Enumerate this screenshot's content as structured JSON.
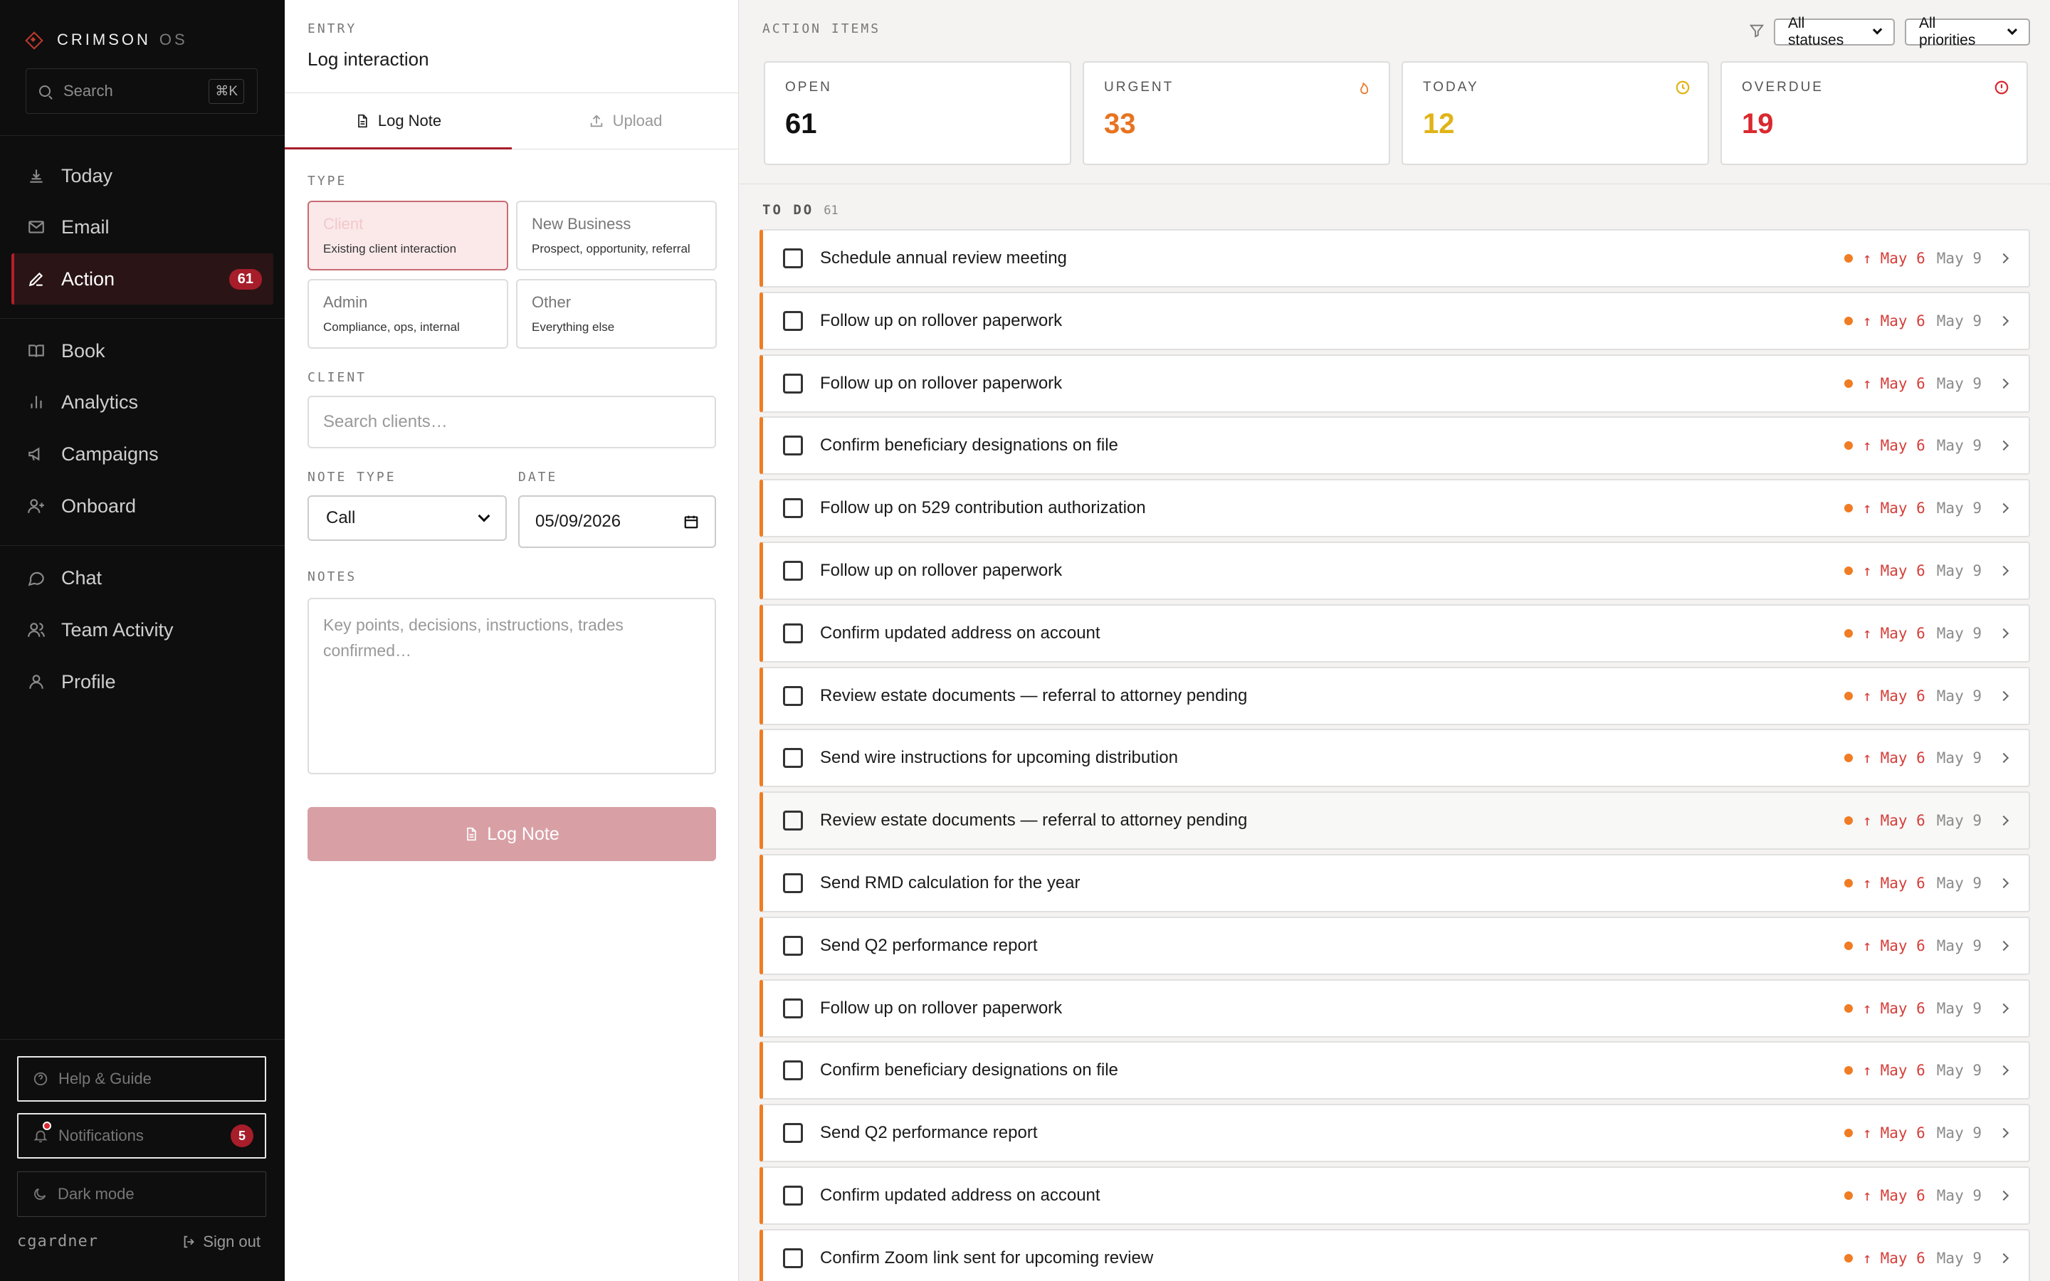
{
  "brand": {
    "name": "CRIMSON",
    "suffix": "OS"
  },
  "search": {
    "placeholder": "Search",
    "shortcut": "⌘K"
  },
  "nav": {
    "items": [
      {
        "label": "Today",
        "icon": "today-icon"
      },
      {
        "label": "Email",
        "icon": "mail-icon"
      },
      {
        "label": "Action",
        "icon": "pencil-icon",
        "badge": "61",
        "active": true
      },
      {
        "label": "Book",
        "icon": "book-icon"
      },
      {
        "label": "Analytics",
        "icon": "bar-chart-icon"
      },
      {
        "label": "Campaigns",
        "icon": "megaphone-icon"
      },
      {
        "label": "Onboard",
        "icon": "user-plus-icon"
      },
      {
        "label": "Chat",
        "icon": "chat-bubble-icon"
      },
      {
        "label": "Team Activity",
        "icon": "users-icon"
      },
      {
        "label": "Profile",
        "icon": "user-icon"
      }
    ]
  },
  "sidebar_footer": {
    "help": "Help & Guide",
    "notifications": "Notifications",
    "notifications_count": "5",
    "dark_mode": "Dark mode",
    "username": "cgardner",
    "sign_out": "Sign out"
  },
  "entry": {
    "label": "ENTRY",
    "title": "Log interaction",
    "tabs": [
      "Log Note",
      "Upload"
    ],
    "type_label": "TYPE",
    "types": [
      {
        "title": "Client",
        "desc": "Existing client interaction",
        "selected": true
      },
      {
        "title": "New Business",
        "desc": "Prospect, opportunity, referral"
      },
      {
        "title": "Admin",
        "desc": "Compliance, ops, internal"
      },
      {
        "title": "Other",
        "desc": "Everything else"
      }
    ],
    "client_label": "CLIENT",
    "client_placeholder": "Search clients…",
    "note_type_label": "NOTE TYPE",
    "note_type_value": "Call",
    "date_label": "DATE",
    "date_value": "05/09/2026",
    "notes_label": "NOTES",
    "notes_placeholder": "Key points, decisions, instructions, trades confirmed…",
    "submit_label": "Log Note"
  },
  "actions": {
    "label": "ACTION ITEMS",
    "status_filter": "All statuses",
    "priority_filter": "All priorities",
    "stats": [
      {
        "label": "OPEN",
        "value": "61",
        "color": "#111111"
      },
      {
        "label": "URGENT",
        "value": "33",
        "color": "#e8731f",
        "icon": "flame-icon"
      },
      {
        "label": "TODAY",
        "value": "12",
        "color": "#e0b417",
        "icon": "clock-icon"
      },
      {
        "label": "OVERDUE",
        "value": "19",
        "color": "#d9282f",
        "icon": "alert-circle-icon"
      }
    ],
    "todo_label": "TO DO",
    "todo_count": "61",
    "items": [
      {
        "title": "Schedule annual review meeting",
        "due": "May 6",
        "created": "May 9"
      },
      {
        "title": "Follow up on rollover paperwork",
        "due": "May 6",
        "created": "May 9"
      },
      {
        "title": "Follow up on rollover paperwork",
        "due": "May 6",
        "created": "May 9"
      },
      {
        "title": "Confirm beneficiary designations on file",
        "due": "May 6",
        "created": "May 9"
      },
      {
        "title": "Follow up on 529 contribution authorization",
        "due": "May 6",
        "created": "May 9"
      },
      {
        "title": "Follow up on rollover paperwork",
        "due": "May 6",
        "created": "May 9"
      },
      {
        "title": "Confirm updated address on account",
        "due": "May 6",
        "created": "May 9"
      },
      {
        "title": "Review estate documents — referral to attorney pending",
        "due": "May 6",
        "created": "May 9"
      },
      {
        "title": "Send wire instructions for upcoming distribution",
        "due": "May 6",
        "created": "May 9"
      },
      {
        "title": "Review estate documents — referral to attorney pending",
        "due": "May 6",
        "created": "May 9"
      },
      {
        "title": "Send RMD calculation for the year",
        "due": "May 6",
        "created": "May 9"
      },
      {
        "title": "Send Q2 performance report",
        "due": "May 6",
        "created": "May 9"
      },
      {
        "title": "Follow up on rollover paperwork",
        "due": "May 6",
        "created": "May 9"
      },
      {
        "title": "Confirm beneficiary designations on file",
        "due": "May 6",
        "created": "May 9"
      },
      {
        "title": "Send Q2 performance report",
        "due": "May 6",
        "created": "May 9"
      },
      {
        "title": "Confirm updated address on account",
        "due": "May 6",
        "created": "May 9"
      },
      {
        "title": "Confirm Zoom link sent for upcoming review",
        "due": "May 6",
        "created": "May 9"
      }
    ],
    "priority_arrow": "↑",
    "accent": "#f07c23"
  }
}
